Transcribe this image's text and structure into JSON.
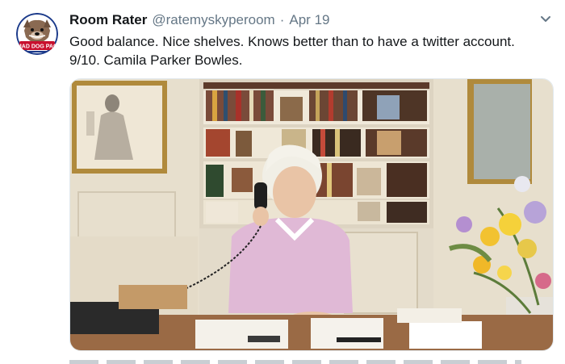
{
  "tweet": {
    "display_name": "Room Rater",
    "handle": "@ratemyskyperoom",
    "separator": "·",
    "date": "Apr 19",
    "text_line1": "Good balance. Nice shelves. Knows better than to have a twitter account.",
    "text_line2": "9/10. Camila Parker Bowles.",
    "avatar_text": "MAD DOG PAC",
    "icons": {
      "avatar": "dog-avatar-icon",
      "menu": "chevron-down-icon"
    }
  },
  "colors": {
    "name": "#14171a",
    "muted": "#657786",
    "avatar_red": "#c8102e",
    "avatar_blue": "#1b3a8a"
  }
}
